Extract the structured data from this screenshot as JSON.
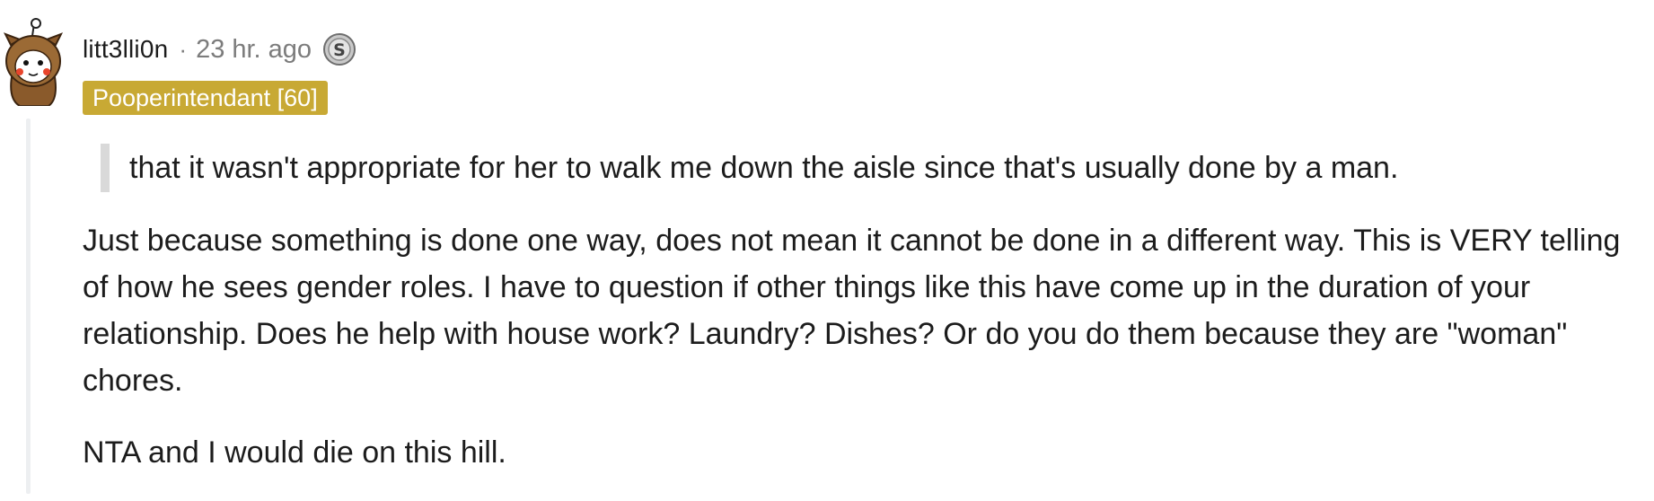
{
  "comment": {
    "username": "litt3lli0n",
    "separator": "·",
    "timestamp": "23 hr. ago",
    "award_icon": "silver-award-icon",
    "flair": "Pooperintendant [60]",
    "quote": "that it wasn't appropriate for her to walk me down the aisle since that's usually done by a man.",
    "paragraphs": [
      "Just because something is done one way, does not mean it cannot be done in a different way. This is VERY telling of how he sees gender roles. I have to question if other things like this have come up in the duration of your relationship. Does he help with house work? Laundry? Dishes? Or do you do them because they are \"woman\" chores.",
      "NTA and I would die on this hill."
    ]
  },
  "colors": {
    "flair_background": "#c8a934",
    "meta_text": "#7c7c7c",
    "thread_line": "#edeff1",
    "quote_bar": "#d9d9d9"
  }
}
